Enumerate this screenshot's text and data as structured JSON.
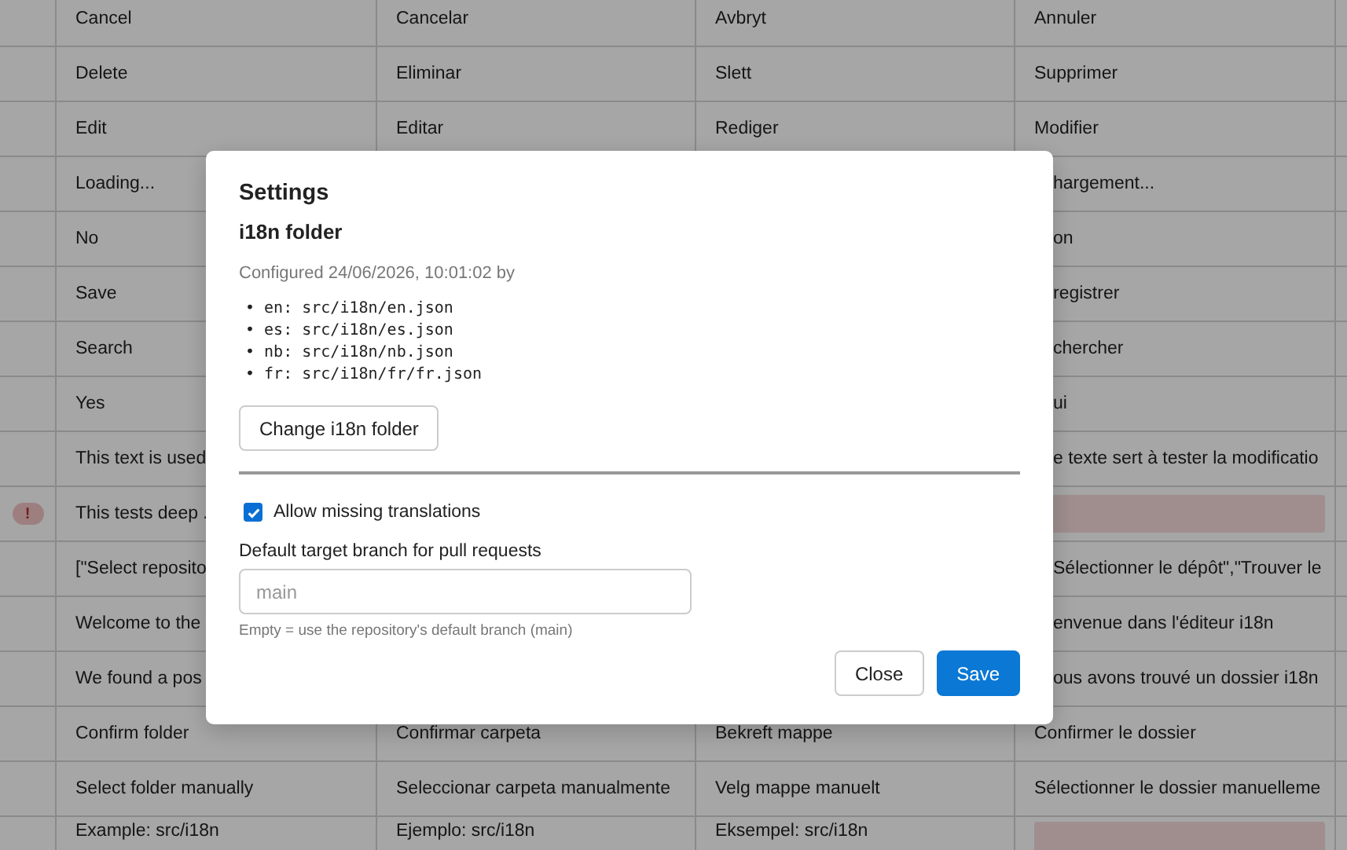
{
  "table": {
    "rows": [
      {
        "warning": false,
        "cells": [
          {
            "text": "Cancel"
          },
          {
            "text": "Cancelar"
          },
          {
            "text": "Avbryt"
          },
          {
            "text": "Annuler"
          }
        ]
      },
      {
        "warning": false,
        "cells": [
          {
            "text": "Delete"
          },
          {
            "text": "Eliminar"
          },
          {
            "text": "Slett"
          },
          {
            "text": "Supprimer"
          }
        ]
      },
      {
        "warning": false,
        "cells": [
          {
            "text": "Edit"
          },
          {
            "text": "Editar"
          },
          {
            "text": "Rediger"
          },
          {
            "text": "Modifier"
          }
        ]
      },
      {
        "warning": false,
        "cells": [
          {
            "text": "Loading..."
          },
          null,
          null,
          {
            "text": "hargement...",
            "partial": true
          }
        ]
      },
      {
        "warning": false,
        "cells": [
          {
            "text": "No"
          },
          null,
          null,
          {
            "text": "on",
            "partial": true
          }
        ]
      },
      {
        "warning": false,
        "cells": [
          {
            "text": "Save"
          },
          null,
          null,
          {
            "text": "registrer",
            "partial": true
          }
        ]
      },
      {
        "warning": false,
        "cells": [
          {
            "text": "Search"
          },
          null,
          null,
          {
            "text": "chercher",
            "partial": true
          }
        ]
      },
      {
        "warning": false,
        "cells": [
          {
            "text": "Yes"
          },
          null,
          null,
          {
            "text": "ui",
            "partial": true
          }
        ]
      },
      {
        "warning": false,
        "cells": [
          {
            "text": "This text is used"
          },
          null,
          null,
          {
            "text": "e texte sert à tester la modificatio",
            "partial": true
          }
        ]
      },
      {
        "warning": true,
        "warning_mark": "!",
        "cells": [
          {
            "text": "This tests deep ."
          },
          null,
          null,
          {
            "missing": true
          }
        ]
      },
      {
        "warning": false,
        "cells": [
          {
            "text": "[\"Select reposito"
          },
          null,
          null,
          {
            "text": "Sélectionner le dépôt\",\"Trouver le",
            "partial": true
          }
        ]
      },
      {
        "warning": false,
        "cells": [
          {
            "text": "Welcome to the"
          },
          null,
          null,
          {
            "text": "envenue dans l'éditeur i18n",
            "partial": true
          }
        ]
      },
      {
        "warning": false,
        "cells": [
          {
            "text": "We found a pos"
          },
          null,
          null,
          {
            "text": "ous avons trouvé un dossier i18n",
            "partial": true
          }
        ]
      },
      {
        "warning": false,
        "cells": [
          {
            "text": "Confirm folder"
          },
          {
            "text": "Confirmar carpeta"
          },
          {
            "text": "Bekreft mappe"
          },
          {
            "text": "Confirmer le dossier"
          }
        ]
      },
      {
        "warning": false,
        "cells": [
          {
            "text": "Select folder manually"
          },
          {
            "text": "Seleccionar carpeta manualmente"
          },
          {
            "text": "Velg mappe manuelt"
          },
          {
            "text": "Sélectionner le dossier manuelleme"
          }
        ]
      },
      {
        "warning": false,
        "cells": [
          {
            "text": "Example: src/i18n"
          },
          {
            "text": "Ejemplo: src/i18n"
          },
          {
            "text": "Eksempel: src/i18n"
          },
          {
            "missing": true
          }
        ]
      }
    ]
  },
  "dialog": {
    "title": "Settings",
    "section": "i18n folder",
    "configured": "Configured 24/06/2026, 10:01:02 by",
    "paths": [
      {
        "marker": "•",
        "text": "en: src/i18n/en.json"
      },
      {
        "marker": "•",
        "text": "es: src/i18n/es.json"
      },
      {
        "marker": "•",
        "text": "nb: src/i18n/nb.json"
      },
      {
        "marker": "•",
        "text": "fr: src/i18n/fr/fr.json"
      }
    ],
    "change_button": "Change i18n folder",
    "allow_missing": {
      "label": "Allow missing translations",
      "checked": true
    },
    "branch": {
      "label": "Default target branch for pull requests",
      "placeholder": "main",
      "hint": "Empty = use the repository's default branch (main)"
    },
    "buttons": [
      {
        "label": "Close",
        "kind": "secondary"
      },
      {
        "label": "Save",
        "kind": "primary"
      }
    ]
  }
}
